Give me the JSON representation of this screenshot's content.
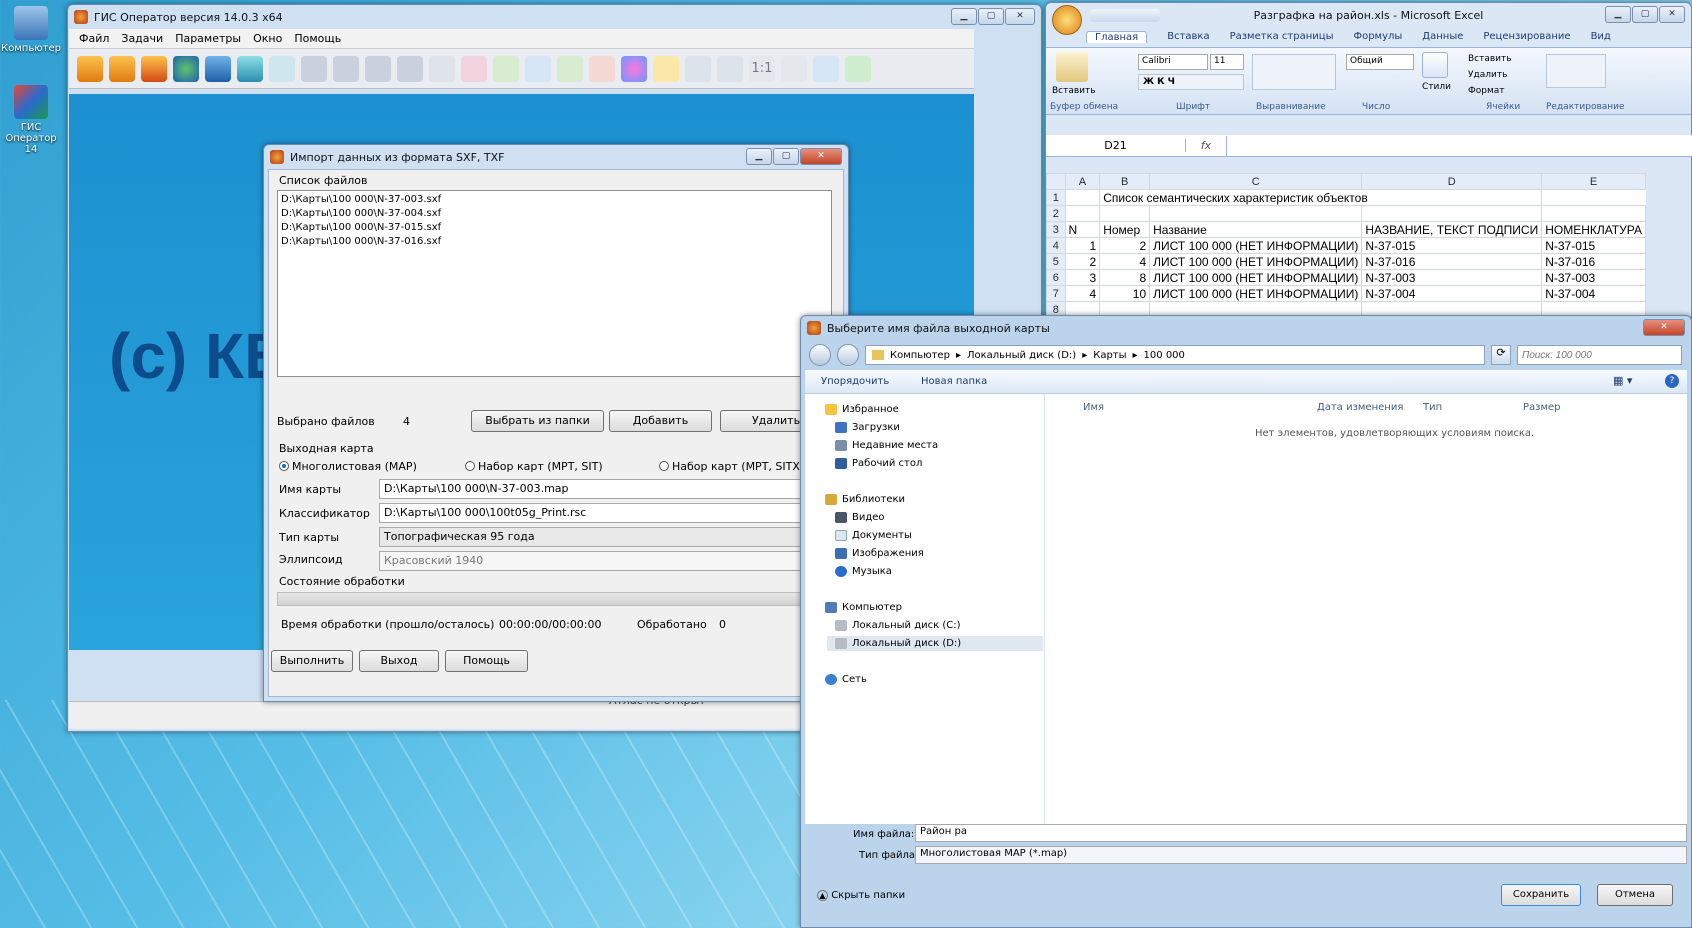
{
  "desktop": {
    "icon_computer": "Компьютер",
    "icon_gis": "ГИС Оператор 14"
  },
  "gis": {
    "title": "ГИС Оператор версия 14.0.3 x64",
    "menu": [
      "Файл",
      "Задачи",
      "Параметры",
      "Окно",
      "Помощь"
    ],
    "watermark": "(c) КБ",
    "status_fragment": "Атлас не открыт"
  },
  "import_dialog": {
    "title": "Импорт данных из формата SXF, TXF",
    "files_label": "Список файлов",
    "files": [
      "D:\\Карты\\100 000\\N-37-003.sxf",
      "D:\\Карты\\100 000\\N-37-004.sxf",
      "D:\\Карты\\100 000\\N-37-015.sxf",
      "D:\\Карты\\100 000\\N-37-016.sxf"
    ],
    "selected_label": "Выбрано файлов",
    "selected_count": "4",
    "btn_from_folder": "Выбрать из папки",
    "btn_add": "Добавить",
    "btn_delete": "Удалить",
    "output_label": "Выходная карта",
    "radio_map": "Многолистовая (MAP)",
    "radio_mpt": "Набор карт (MPT, SIT)",
    "radio_sitx": "Набор карт (MPT, SITX)",
    "map_name_label": "Имя карты",
    "map_name": "D:\\Карты\\100 000\\N-37-003.map",
    "classifier_label": "Классификатор",
    "classifier": "D:\\Карты\\100 000\\100t05g_Print.rsc",
    "map_type_label": "Тип карты",
    "map_type": "Топографическая 95 года",
    "ellipsoid_label": "Эллипсоид",
    "ellipsoid": "Красовский 1940",
    "status_label": "Состояние обработки",
    "time_label": "Время обработки (прошло/осталось)",
    "time_value": "00:00:00/00:00:00",
    "processed_label": "Обработано",
    "processed_value": "0",
    "btn_run": "Выполнить",
    "btn_exit": "Выход",
    "btn_help": "Помощь"
  },
  "excel": {
    "title": "Разграфка на район.xls - Microsoft Excel",
    "tabs": [
      "Главная",
      "Вставка",
      "Разметка страницы",
      "Формулы",
      "Данные",
      "Рецензирование",
      "Вид"
    ],
    "groups": [
      "Буфер обмена",
      "Шрифт",
      "Выравнивание",
      "Число",
      "Ячейки",
      "Редактирование"
    ],
    "paste": "Вставить",
    "font": "Calibri",
    "font_size": "11",
    "number_format": "Общий",
    "styles": "Стили",
    "insert": "Вставить",
    "delete": "Удалить",
    "format": "Формат",
    "name_box": "D21",
    "fx": "fx",
    "columns": [
      "A",
      "B",
      "C",
      "D",
      "E"
    ],
    "rows": [
      [
        "1",
        "",
        "Список семантических характеристик объектов",
        "",
        ""
      ],
      [
        "2",
        "",
        "",
        "",
        ""
      ],
      [
        "3",
        "N",
        "Номер",
        "Название",
        "НАЗВАНИЕ, ТЕКСТ ПОДПИСИ",
        "НОМЕНКЛАТУРА"
      ],
      [
        "4",
        "1",
        "2",
        "ЛИСТ 100 000 (НЕТ ИНФОРМАЦИИ)",
        "N-37-015",
        "N-37-015"
      ],
      [
        "5",
        "2",
        "4",
        "ЛИСТ 100 000 (НЕТ ИНФОРМАЦИИ)",
        "N-37-016",
        "N-37-016"
      ],
      [
        "6",
        "3",
        "8",
        "ЛИСТ 100 000 (НЕТ ИНФОРМАЦИИ)",
        "N-37-003",
        "N-37-003"
      ],
      [
        "7",
        "4",
        "10",
        "ЛИСТ 100 000 (НЕТ ИНФОРМАЦИИ)",
        "N-37-004",
        "N-37-004"
      ],
      [
        "8",
        "",
        "",
        "",
        "",
        ""
      ]
    ]
  },
  "save_dialog": {
    "title": "Выберите имя файла выходной карты",
    "breadcrumb": [
      "Компьютер",
      "Локальный диск (D:)",
      "Карты",
      "100 000"
    ],
    "search_placeholder": "Поиск: 100 000",
    "organize": "Упорядочить",
    "new_folder": "Новая папка",
    "nav": [
      "Избранное",
      "Загрузки",
      "Недавние места",
      "Рабочий стол",
      "Библиотеки",
      "Видео",
      "Документы",
      "Изображения",
      "Музыка",
      "Компьютер",
      "Локальный диск (C:)",
      "Локальный диск (D:)",
      "Сеть"
    ],
    "col_name": "Имя",
    "col_date": "Дата изменения",
    "col_type": "Тип",
    "col_size": "Размер",
    "empty_msg": "Нет элементов, удовлетворяющих условиям поиска.",
    "filename_label": "Имя файла:",
    "filename": "Район ра",
    "filetype_label": "Тип файла:",
    "filetype": "Многолистовая MAP (*.map)",
    "hide_folders": "Скрыть папки",
    "btn_save": "Сохранить",
    "btn_cancel": "Отмена"
  }
}
